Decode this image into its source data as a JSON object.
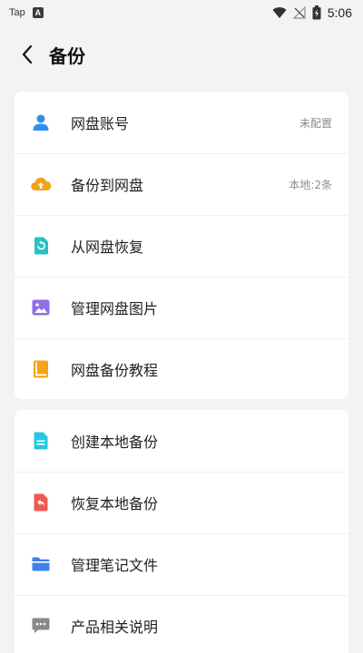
{
  "status_bar": {
    "left_app_text": "Tap",
    "left_icon_letter": "A",
    "time": "5:06",
    "icons": [
      "wifi-icon",
      "no-signal-icon",
      "battery-icon"
    ]
  },
  "header": {
    "title": "备份",
    "back_icon": "chevron-left-icon"
  },
  "group1": [
    {
      "label": "网盘账号",
      "value": "未配置",
      "icon": "user-icon",
      "color": "#2f8ff1"
    },
    {
      "label": "备份到网盘",
      "value": "本地:2条",
      "icon": "cloud-upload-icon",
      "color": "#f5a21b"
    },
    {
      "label": "从网盘恢复",
      "value": "",
      "icon": "restore-icon",
      "color": "#27c2c3"
    },
    {
      "label": "管理网盘图片",
      "value": "",
      "icon": "image-icon",
      "color": "#8f6ee6"
    },
    {
      "label": "网盘备份教程",
      "value": "",
      "icon": "book-icon",
      "color": "#f5a21b"
    }
  ],
  "group2": [
    {
      "label": "创建本地备份",
      "value": "",
      "icon": "document-icon",
      "color": "#27c6e0"
    },
    {
      "label": "恢复本地备份",
      "value": "",
      "icon": "file-undo-icon",
      "color": "#f05a4f"
    },
    {
      "label": "管理笔记文件",
      "value": "",
      "icon": "folder-icon",
      "color": "#3f7fee"
    },
    {
      "label": "产品相关说明",
      "value": "",
      "icon": "chat-icon",
      "color": "#8a8a8a"
    }
  ]
}
